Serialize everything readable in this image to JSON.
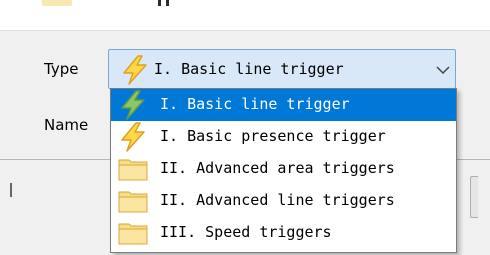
{
  "form": {
    "type_label": "Type",
    "name_label": "Name",
    "type_selected": "I. Basic line trigger"
  },
  "dropdown": {
    "options": [
      {
        "label": "I. Basic line trigger",
        "icon": "lightning-bolt-icon",
        "selected": true
      },
      {
        "label": "I. Basic presence trigger",
        "icon": "lightning-bolt-icon",
        "selected": false
      },
      {
        "label": "II. Advanced area triggers",
        "icon": "folder-icon",
        "selected": false
      },
      {
        "label": "II. Advanced line triggers",
        "icon": "folder-icon",
        "selected": false
      },
      {
        "label": "III. Speed triggers",
        "icon": "folder-icon",
        "selected": false
      }
    ]
  },
  "colors": {
    "selection": "#0078d7",
    "combo_background": "#d8e8f8",
    "combo_border": "#7aa7d6",
    "bolt_fill": "#ffd84a",
    "bolt_stroke": "#e0a020",
    "folder_fill": "#f8dc86",
    "folder_stroke": "#d9a93a"
  }
}
